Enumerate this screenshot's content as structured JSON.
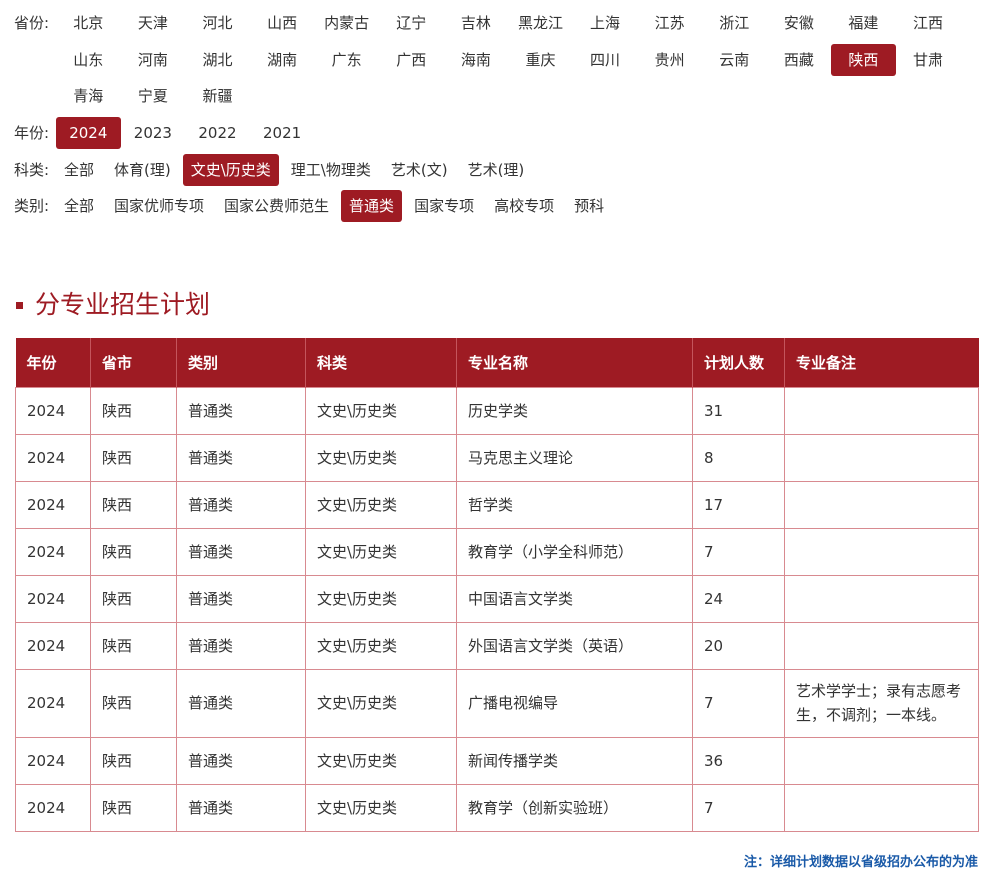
{
  "filters": {
    "province": {
      "label": "省份:",
      "options": [
        "北京",
        "天津",
        "河北",
        "山西",
        "内蒙古",
        "辽宁",
        "吉林",
        "黑龙江",
        "上海",
        "江苏",
        "浙江",
        "安徽",
        "福建",
        "江西",
        "山东",
        "河南",
        "湖北",
        "湖南",
        "广东",
        "广西",
        "海南",
        "重庆",
        "四川",
        "贵州",
        "云南",
        "西藏",
        "陕西",
        "甘肃",
        "青海",
        "宁夏",
        "新疆"
      ],
      "selected": "陕西"
    },
    "year": {
      "label": "年份:",
      "options": [
        "2024",
        "2023",
        "2022",
        "2021"
      ],
      "selected": "2024"
    },
    "subject": {
      "label": "科类:",
      "options": [
        "全部",
        "体育(理)",
        "文史\\历史类",
        "理工\\物理类",
        "艺术(文)",
        "艺术(理)"
      ],
      "selected": "文史\\历史类"
    },
    "category": {
      "label": "类别:",
      "options": [
        "全部",
        "国家优师专项",
        "国家公费师范生",
        "普通类",
        "国家专项",
        "高校专项",
        "预科"
      ],
      "selected": "普通类"
    }
  },
  "section_title": "分专业招生计划",
  "table": {
    "headers": [
      "年份",
      "省市",
      "类别",
      "科类",
      "专业名称",
      "计划人数",
      "专业备注"
    ],
    "rows": [
      [
        "2024",
        "陕西",
        "普通类",
        "文史\\历史类",
        "历史学类",
        "31",
        ""
      ],
      [
        "2024",
        "陕西",
        "普通类",
        "文史\\历史类",
        "马克思主义理论",
        "8",
        ""
      ],
      [
        "2024",
        "陕西",
        "普通类",
        "文史\\历史类",
        "哲学类",
        "17",
        ""
      ],
      [
        "2024",
        "陕西",
        "普通类",
        "文史\\历史类",
        "教育学（小学全科师范）",
        "7",
        ""
      ],
      [
        "2024",
        "陕西",
        "普通类",
        "文史\\历史类",
        "中国语言文学类",
        "24",
        ""
      ],
      [
        "2024",
        "陕西",
        "普通类",
        "文史\\历史类",
        "外国语言文学类（英语）",
        "20",
        ""
      ],
      [
        "2024",
        "陕西",
        "普通类",
        "文史\\历史类",
        "广播电视编导",
        "7",
        "艺术学学士；录有志愿考生，不调剂；一本线。"
      ],
      [
        "2024",
        "陕西",
        "普通类",
        "文史\\历史类",
        "新闻传播学类",
        "36",
        ""
      ],
      [
        "2024",
        "陕西",
        "普通类",
        "文史\\历史类",
        "教育学（创新实验班）",
        "7",
        ""
      ]
    ]
  },
  "footnote": "注：详细计划数据以省级招办公布的为准",
  "colors": {
    "accent": "#9e1b23",
    "note": "#1a5aa8",
    "row_border": "#d88a90"
  }
}
